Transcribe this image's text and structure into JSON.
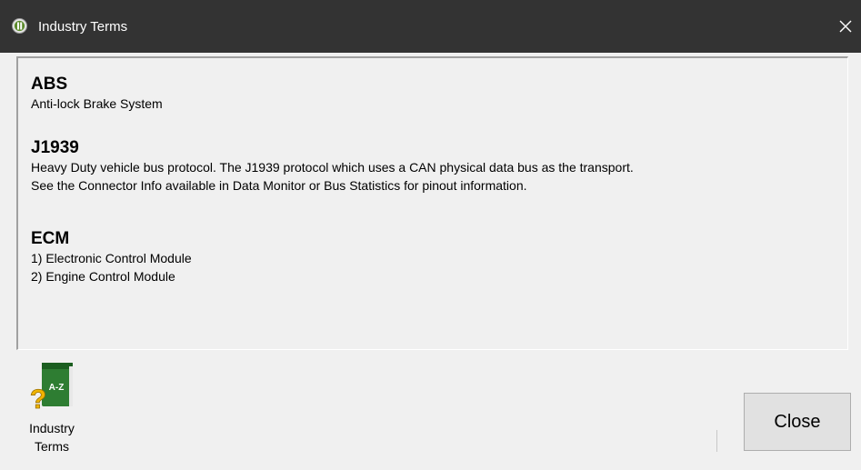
{
  "window": {
    "title": "Industry Terms",
    "icon": "app-logo-icon",
    "close_icon": "close-icon"
  },
  "terms": [
    {
      "name": "ABS",
      "lines": [
        "Anti-lock Brake System"
      ]
    },
    {
      "name": "J1939",
      "lines": [
        "Heavy Duty vehicle bus protocol.  The J1939 protocol which uses a CAN physical data bus as the transport.",
        "See the Connector Info available in Data Monitor or Bus Statistics for pinout information."
      ]
    },
    {
      "name": "ECM",
      "lines": [
        "1) Electronic Control Module",
        "2) Engine Control Module"
      ]
    }
  ],
  "toolbar": {
    "industry_terms_label_line1": "Industry",
    "industry_terms_label_line2": "Terms",
    "industry_terms_icon": "dictionary-book-icon",
    "book_text": "A-Z",
    "close_label": "Close"
  },
  "colors": {
    "titlebar": "#333333",
    "window_bg": "#f0f0f0",
    "book_green": "#2e7d32",
    "question_yellow": "#f0b400"
  }
}
